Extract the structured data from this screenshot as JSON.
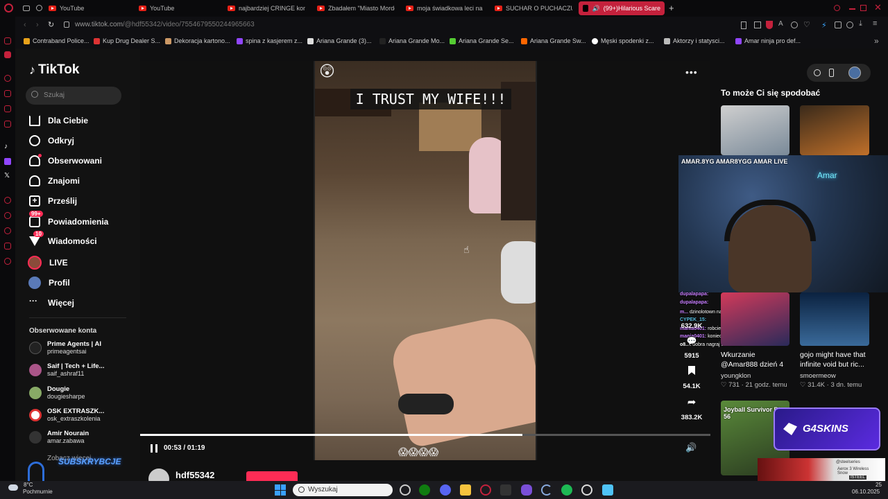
{
  "browser": {
    "tabs": [
      {
        "label": "YouTube",
        "kind": "youtube"
      },
      {
        "label": "YouTube",
        "kind": "youtube"
      },
      {
        "label": "najbardziej CRINGE konto",
        "kind": "youtube"
      },
      {
        "label": "Zbadałem \"Miasto Morde",
        "kind": "youtube"
      },
      {
        "label": "moja świadkowa leci na m",
        "kind": "youtube"
      },
      {
        "label": "SUCHAR O PUCHACZU!",
        "kind": "youtube"
      },
      {
        "label": "(99+)Hilarious Scare",
        "kind": "tiktok"
      }
    ],
    "new_tab_label": "+",
    "url_host": "www.tiktok.com",
    "url_path": "/@hdf55342/video/7554679550244965663",
    "bookmarks": [
      {
        "label": "Contraband Police...",
        "color": "#e8a21a"
      },
      {
        "label": "Kup Drug Dealer S...",
        "color": "#d33"
      },
      {
        "label": "Dekoracja kartono...",
        "color": "#c96"
      },
      {
        "label": "spina z kasjerem z...",
        "color": "#9146ff"
      },
      {
        "label": "Ariana Grande (3)...",
        "color": "#ddd"
      },
      {
        "label": "Ariana Grande Mo...",
        "color": "#222"
      },
      {
        "label": "Ariana Grande Se...",
        "color": "#5c3"
      },
      {
        "label": "Ariana Grande Sw...",
        "color": "#f60"
      },
      {
        "label": "Męski spodenki z...",
        "color": "#fff"
      },
      {
        "label": "Aktorzy i statysci...",
        "color": "#bbb"
      },
      {
        "label": "Amar ninja pro def...",
        "color": "#9146ff"
      }
    ]
  },
  "sidebar": {
    "brand": "TikTok",
    "search_placeholder": "Szukaj",
    "nav": [
      {
        "label": "Dla Ciebie",
        "icon": "home-icon"
      },
      {
        "label": "Odkryj",
        "icon": "compass-icon"
      },
      {
        "label": "Obserwowani",
        "icon": "following-icon"
      },
      {
        "label": "Znajomi",
        "icon": "friends-icon"
      },
      {
        "label": "Prześlij",
        "icon": "upload-icon"
      },
      {
        "label": "Powiadomienia",
        "icon": "inbox-icon",
        "badge": "99+"
      },
      {
        "label": "Wiadomości",
        "icon": "messages-icon",
        "badge": "10"
      },
      {
        "label": "LIVE",
        "icon": "live-icon"
      },
      {
        "label": "Profil",
        "icon": "profile-icon"
      },
      {
        "label": "Więcej",
        "icon": "more-icon"
      }
    ],
    "following_title": "Obserwowane konta",
    "following": [
      {
        "name": "Prime Agents | AI",
        "handle": "primeagentsai",
        "color": "#222"
      },
      {
        "name": "Saif | Tech + Life...",
        "handle": "saif_ashraf11",
        "color": "#a58"
      },
      {
        "name": "Dougie",
        "handle": "dougiesharpe",
        "color": "#8a6"
      },
      {
        "name": "OSK EXTRASZK...",
        "handle": "osk_extraszkolenia",
        "color": "#fff"
      },
      {
        "name": "Amir Nourain",
        "handle": "amar.zabawa",
        "color": "#333"
      }
    ],
    "see_more": "Zobacz więcej",
    "overlay_subscribe": "SUBSKRYBCJE"
  },
  "player": {
    "caption": "I TRUST MY WIFE!!!",
    "time_current": "00:53",
    "time_total": "01:19",
    "progress_fraction": 0.67,
    "bottom_emojis": "😱😱😱😱",
    "author_partial": "hdf55342"
  },
  "actions": {
    "likes": "632.9K",
    "comments": "5915",
    "saves": "54.1K",
    "shares": "383.2K"
  },
  "suggestions": {
    "title": "To może Ci się spodobać",
    "items": [
      {
        "title": "Wkurzanie @Amar888 dzień 4",
        "author": "youngklon",
        "likes": "731",
        "age": "21 godz. temu"
      },
      {
        "title": "gojo might have that infinite void but ric...",
        "author": "smoermeow",
        "likes": "31.4K",
        "age": "3 dn. temu"
      }
    ],
    "joyball_text": "Joyball Survivor Pt 56"
  },
  "stream_overlay": {
    "socials": "AMAR.8YG  AMAR8YGG  AMAR LIVE",
    "chat": [
      {
        "user": "dupalapapa:",
        "msg": ""
      },
      {
        "user": "dupalapapa:",
        "msg": ""
      },
      {
        "user": "m...",
        "msg": "dzinolotown na lysa banie"
      },
      {
        "user": "CYPEK_15:",
        "msg": ""
      },
      {
        "user": "mania0401:",
        "msg": "robcie to"
      },
      {
        "user": "mania0401:",
        "msg": "konieczie"
      },
      {
        "user": "o8...:",
        "msg": "dobra nagraj to z alesie"
      }
    ],
    "sponsor": "G4SKINS",
    "ad_text": "Aerox 3 Wireless Snow",
    "ad_brand": "@steelseries",
    "ad_store": "ISTEEL"
  },
  "taskbar": {
    "weather_temp": "8°C",
    "weather_desc": "Pochmurnie",
    "search_placeholder": "Wyszukaj",
    "date": "06.10.2025",
    "time_partial": "25"
  },
  "colors": {
    "opera_red": "#c4213c",
    "tiktok_pink": "#fe2c55",
    "sidebar_bg": "#121212"
  }
}
